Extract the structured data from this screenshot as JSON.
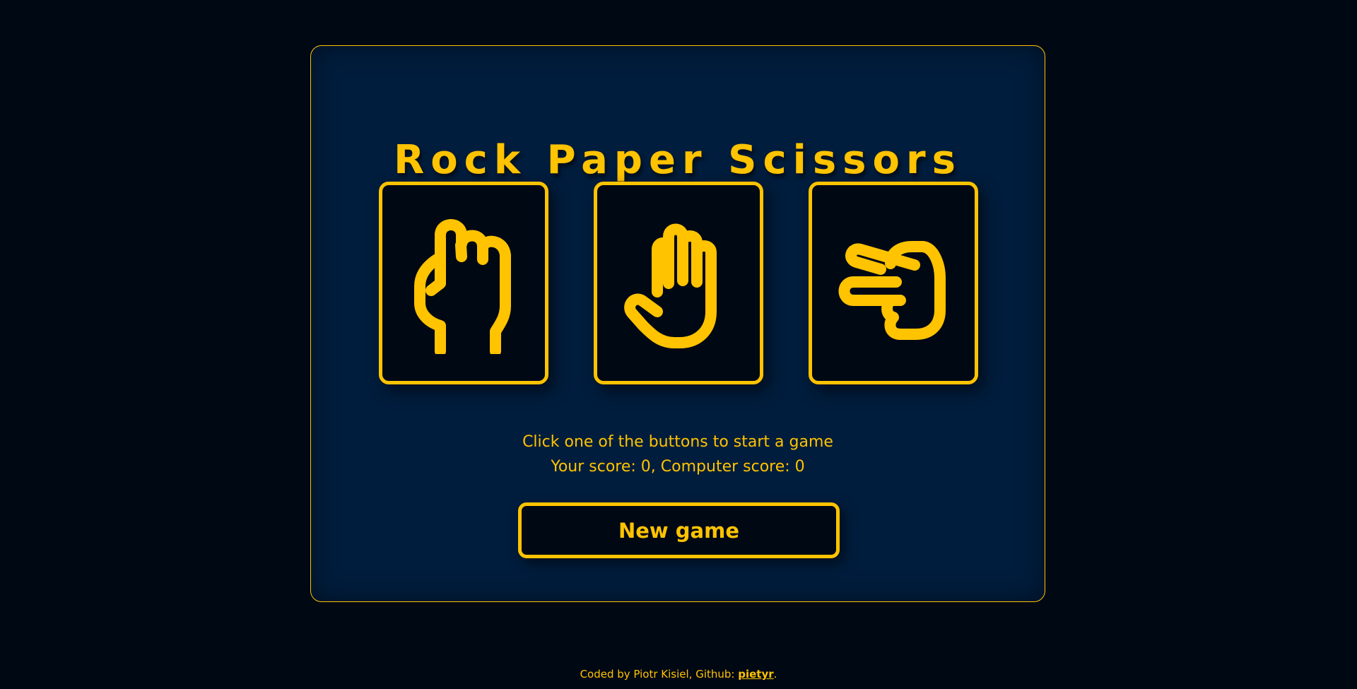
{
  "app": {
    "title": "Rock Paper Scissors"
  },
  "choices": [
    {
      "name": "rock",
      "icon": "rock-fist-icon"
    },
    {
      "name": "paper",
      "icon": "paper-hand-icon"
    },
    {
      "name": "scissors",
      "icon": "scissors-hand-icon"
    }
  ],
  "status": {
    "message": "Click one of the buttons to start a game",
    "score": "Your score: 0, Computer score: 0"
  },
  "controls": {
    "new_game_label": "New game"
  },
  "footer": {
    "prefix": "Coded by Piotr Kisiel, Github: ",
    "link_text": "pietyr",
    "suffix": "."
  },
  "colors": {
    "background": "#000814",
    "panel": "#001d3d",
    "accent": "#ffc300"
  }
}
